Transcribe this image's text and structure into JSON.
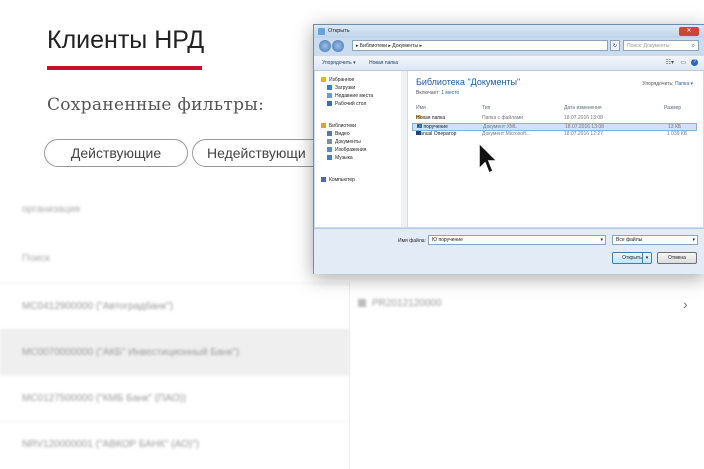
{
  "page": {
    "title": "Клиенты НРД",
    "saved_filters_label": "Сохраненные фильтры:",
    "filters": [
      "Действующие",
      "Недействующи"
    ],
    "field_labels": [
      "организация",
      "Поиск"
    ],
    "clients": [
      {
        "text": "MC0412900000 (\"Автоградбанк\")",
        "selected": false
      },
      {
        "text": "MC0070000000 (\"АКБ\" Инвестиционный Банк\")",
        "selected": true
      },
      {
        "text": "MC0127500000 (\"КМБ Банк\" (ПАО))",
        "selected": false
      },
      {
        "text": "NRV120000001 (\"АВКОР БАНК\" (АО)\")",
        "selected": false
      }
    ],
    "right_row_text": "PR2012120000",
    "right_arrow": "›",
    "accent_color": "#c8102e"
  },
  "dialog": {
    "title": "Открыть",
    "close_label": "✕",
    "address": "▸ Библиотеки ▸ Документы ▸",
    "search_placeholder": "Поиск: Документы",
    "toolbar": {
      "organize": "Упорядочить ▾",
      "new_folder": "Новая папка"
    },
    "nav_items": [
      {
        "label": "Избранное",
        "icon": "star-icon",
        "color": "#e6b800"
      },
      {
        "label": "Загрузки",
        "icon": "downloads-icon",
        "color": "#3a7bd5"
      },
      {
        "label": "Недавние места",
        "icon": "recent-places-icon",
        "color": "#6b9bd1"
      },
      {
        "label": "Рабочий стол",
        "icon": "desktop-icon",
        "color": "#3a6fb5"
      },
      {
        "label": "Библиотеки",
        "icon": "libraries-icon",
        "color": "#d9a431"
      },
      {
        "label": "Видео",
        "icon": "video-icon",
        "color": "#5577aa"
      },
      {
        "label": "Документы",
        "icon": "documents-icon",
        "color": "#7b8fa8"
      },
      {
        "label": "Изображения",
        "icon": "images-icon",
        "color": "#4f8ec9"
      },
      {
        "label": "Музыка",
        "icon": "music-icon",
        "color": "#3f7fd0"
      },
      {
        "label": "Компьютер",
        "icon": "computer-icon",
        "color": "#4a6e99"
      }
    ],
    "library_title": "Библиотека \"Документы\"",
    "library_includes": "Включает:",
    "library_places": "1 место",
    "arrange_label": "Упорядочить:",
    "arrange_value": "Папка ▾",
    "columns": [
      "Имя",
      "Тип",
      "Дата изменения",
      "Размер"
    ],
    "files": [
      {
        "name": "Новая папка",
        "type": "Папка с файлами",
        "date": "18.07.2016 13:08",
        "size": "",
        "icon_color": "#e8c15a",
        "selected": false
      },
      {
        "name": "Ю поручение",
        "type": "Документ XML",
        "date": "18.07.2016 13:08",
        "size": "13 КБ",
        "icon_color": "#4f8ec9",
        "selected": true
      },
      {
        "name": "Manual Оператор",
        "type": "Документ Microsoft...",
        "date": "18.07.2016 12:27",
        "size": "1 039 КБ",
        "icon_color": "#2b5797",
        "selected": false
      }
    ],
    "filename_label": "Имя файла:",
    "filename_value": "Ю поручение",
    "filetype_value": "Все файлы",
    "open_button": "Открыть",
    "cancel_button": "Отмена"
  }
}
